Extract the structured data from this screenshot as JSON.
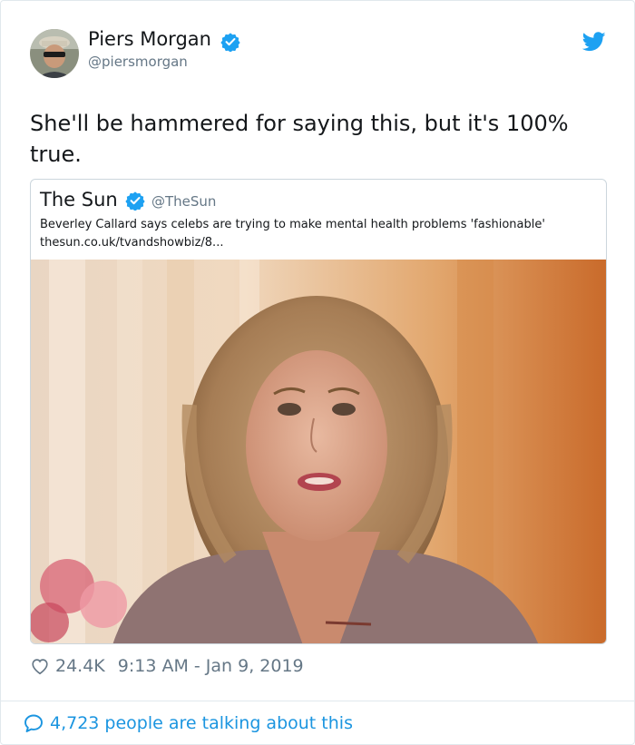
{
  "tweet": {
    "author_name": "Piers Morgan",
    "author_handle": "@piersmorgan",
    "text": "She'll be hammered for saying this, but it's 100% true.",
    "likes": "24.4K",
    "timestamp": "9:13 AM - Jan 9, 2019",
    "talking": "4,723 people are talking about this"
  },
  "quoted_tweet": {
    "author_name": "The Sun",
    "author_handle": "@TheSun",
    "headline": "Beverley Callard says celebs are trying to make mental health problems 'fashionable'",
    "link": "thesun.co.uk/tvandshowbiz/8..."
  },
  "colors": {
    "twitter_blue": "#1da1f2",
    "link_blue": "#1b95e0",
    "secondary_text": "#657786",
    "border": "#e1e8ed"
  },
  "icons": {
    "verified": "verified-badge-icon",
    "brand": "twitter-bird-icon",
    "like": "heart-icon",
    "reply": "speech-bubble-icon"
  }
}
